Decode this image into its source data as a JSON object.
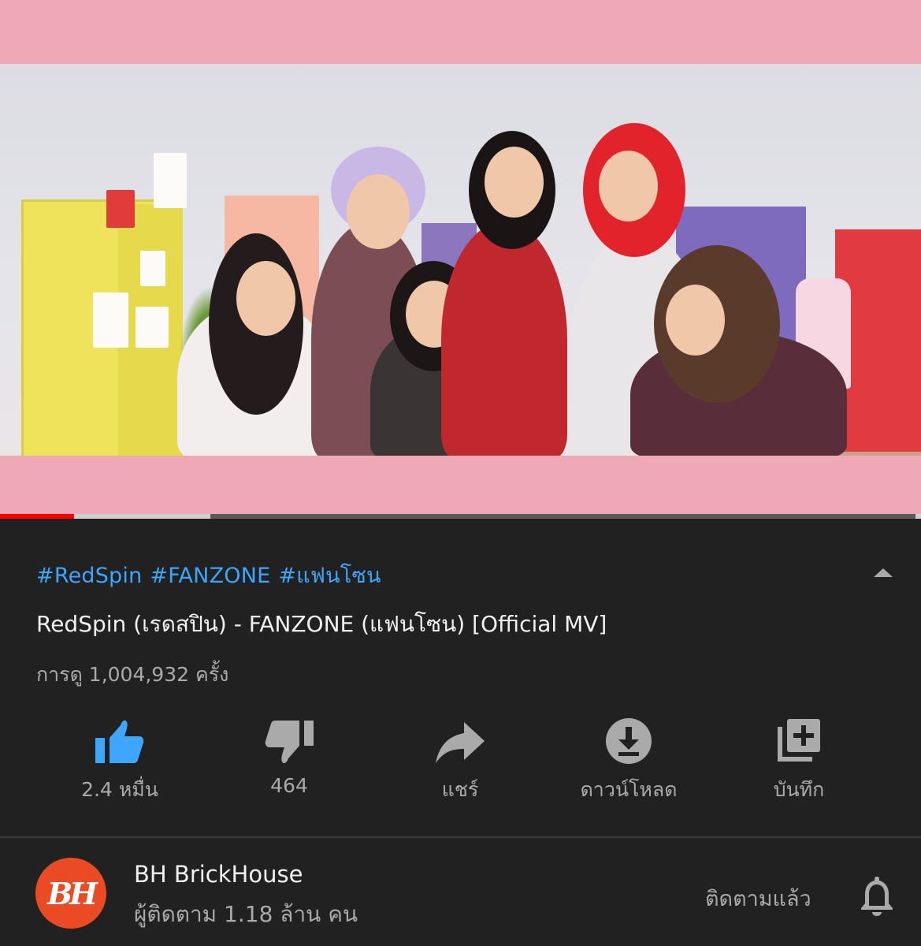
{
  "video": {
    "progress_played": 0.08,
    "progress_buffered": 0.228
  },
  "info": {
    "hashtags": [
      "#RedSpin",
      "#FANZONE",
      "#แฟนโซน"
    ],
    "title": "RedSpin (เรดสปิน) - FANZONE (แฟนโซน) [Official MV]",
    "views": "การดู 1,004,932 ครั้ง"
  },
  "actions": {
    "like": {
      "label": "2.4 หมื่น",
      "icon": "thumbs-up-icon",
      "color": "#3ea6ff"
    },
    "dislike": {
      "label": "464",
      "icon": "thumbs-down-icon"
    },
    "share": {
      "label": "แชร์",
      "icon": "share-icon"
    },
    "download": {
      "label": "ดาวน์โหลด",
      "icon": "download-icon"
    },
    "save": {
      "label": "บันทึก",
      "icon": "playlist-add-icon"
    }
  },
  "channel": {
    "name": "BH BrickHouse",
    "subscribers": "ผู้ติดตาม 1.18 ล้าน คน",
    "subscribe_state": "ติดตามแล้ว",
    "avatar_color": "#ea4b25"
  },
  "colors": {
    "background": "#212121",
    "link": "#3ea6ff",
    "progress": "#ff0000",
    "letterbox": "#efa9b6"
  }
}
